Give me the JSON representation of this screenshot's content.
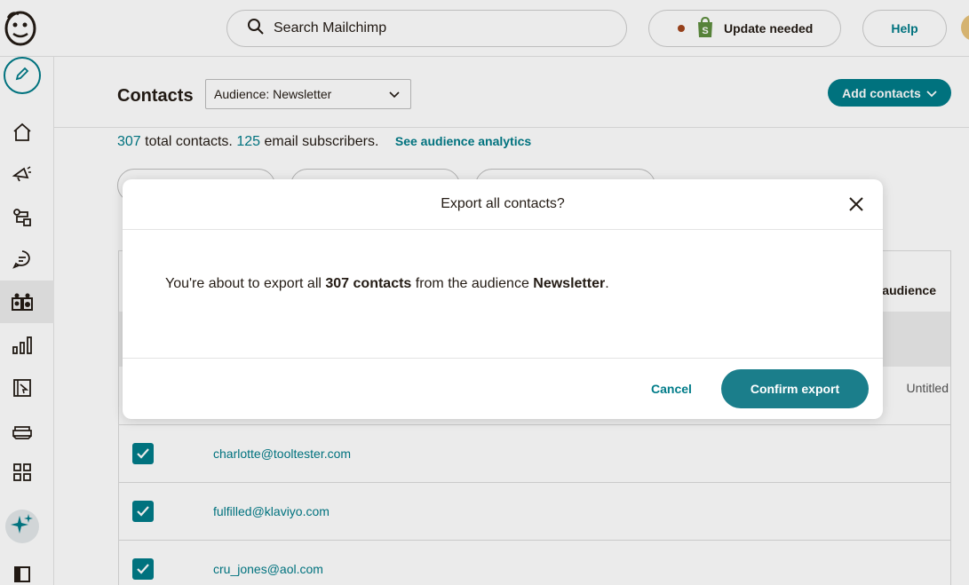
{
  "topbar": {
    "search_placeholder": "Search Mailchimp",
    "update_label": "Update needed",
    "help_label": "Help"
  },
  "sidebar": {
    "items": [
      {
        "icon": "home-icon"
      },
      {
        "icon": "campaigns-icon"
      },
      {
        "icon": "automations-icon"
      },
      {
        "icon": "inbox-icon"
      },
      {
        "icon": "audience-icon",
        "active": true
      },
      {
        "icon": "analytics-icon"
      },
      {
        "icon": "website-icon"
      },
      {
        "icon": "content-icon"
      },
      {
        "icon": "integrations-icon"
      }
    ]
  },
  "page": {
    "title": "Contacts",
    "audience_select": "Audience: Newsletter",
    "add_contacts": "Add contacts",
    "stats": {
      "total": "307",
      "total_label": "total contacts.",
      "subscribers": "125",
      "subscribers_label": "email subscribers.",
      "analytics_link": "See audience analytics"
    },
    "table": {
      "audience_header": "audience",
      "untitled_cell": "Untitled",
      "rows": [
        {
          "email": "charlotte@tooltester.com",
          "checked": true
        },
        {
          "email": "fulfilled@klaviyo.com",
          "checked": true
        },
        {
          "email": "cru_jones@aol.com",
          "checked": true
        }
      ]
    }
  },
  "modal": {
    "title": "Export all contacts?",
    "body_prefix": "You're about to export all ",
    "body_count": "307 contacts",
    "body_mid": " from the audience ",
    "body_audience": "Newsletter",
    "body_suffix": ".",
    "cancel_label": "Cancel",
    "confirm_label": "Confirm export"
  },
  "colors": {
    "accent": "#007c89",
    "confirm_button": "#1b7e8b"
  }
}
